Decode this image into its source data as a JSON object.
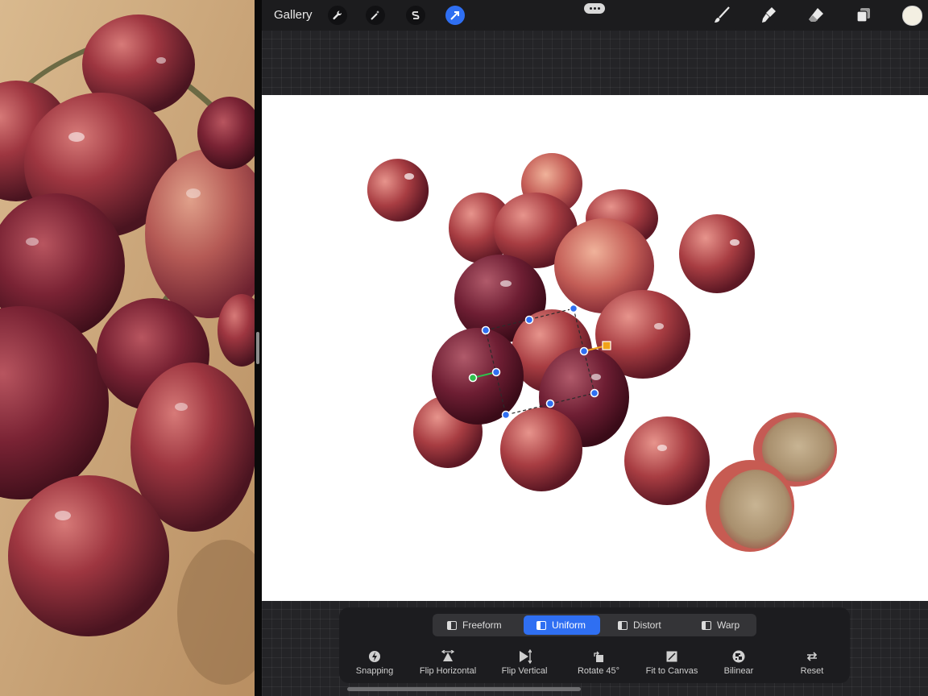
{
  "toolbar": {
    "gallery_label": "Gallery",
    "left_tools": [
      {
        "icon": "wrench-icon",
        "name": "actions"
      },
      {
        "icon": "magic-wand-icon",
        "name": "adjustments"
      },
      {
        "icon": "selection-s-icon",
        "name": "selection"
      },
      {
        "icon": "transform-arrow-icon",
        "name": "transform",
        "active": true
      }
    ],
    "right_tools": [
      {
        "icon": "brush-icon",
        "name": "paint"
      },
      {
        "icon": "smudge-icon",
        "name": "smudge"
      },
      {
        "icon": "eraser-icon",
        "name": "erase"
      },
      {
        "icon": "layers-icon",
        "name": "layers"
      }
    ],
    "current_color": "#f3efe2",
    "accent_color": "#2f6ff2"
  },
  "transform": {
    "modes": [
      {
        "label": "Freeform",
        "active": false
      },
      {
        "label": "Uniform",
        "active": true
      },
      {
        "label": "Distort",
        "active": false
      },
      {
        "label": "Warp",
        "active": false
      }
    ],
    "actions": [
      {
        "label": "Snapping",
        "icon": "snapping-icon"
      },
      {
        "label": "Flip Horizontal",
        "icon": "flip-horizontal-icon"
      },
      {
        "label": "Flip Vertical",
        "icon": "flip-vertical-icon"
      },
      {
        "label": "Rotate 45°",
        "icon": "rotate-icon"
      },
      {
        "label": "Fit to Canvas",
        "icon": "fit-canvas-icon"
      },
      {
        "label": "Bilinear",
        "icon": "bilinear-icon"
      },
      {
        "label": "Reset",
        "icon": "reset-icon"
      }
    ]
  }
}
